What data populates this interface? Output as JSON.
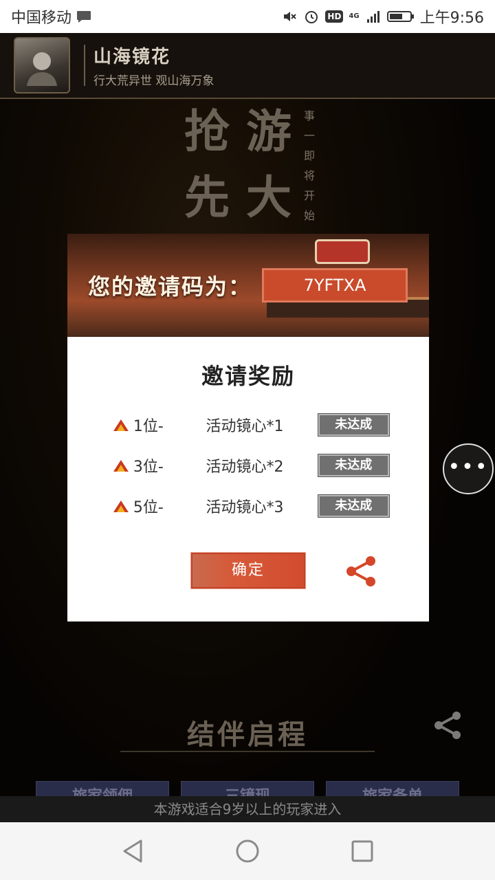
{
  "status_bar": {
    "carrier": "中国移动",
    "hd": "HD",
    "network": "4G",
    "time": "上午9:56"
  },
  "game": {
    "header": {
      "title": "山海镜花",
      "subtitle": "行大荒异世 观山海万象"
    },
    "bg_text": {
      "line1_a": "抢",
      "line1_b": "游",
      "line2_a": "先",
      "line2_b": "大",
      "vertical": "事一即将开始"
    },
    "section_title": "结伴启程",
    "tabs": [
      "旅家领佣",
      "三镜现",
      "旅家备单"
    ],
    "age_notice": "本游戏适合9岁以上的玩家进入"
  },
  "side_more": "•••",
  "modal": {
    "invite_label": "您的邀请码为：",
    "invite_code": "7YFTXA",
    "reward_title": "邀请奖励",
    "rewards": [
      {
        "rank": "1位-",
        "item": "活动镜心*1",
        "status": "未达成"
      },
      {
        "rank": "3位-",
        "item": "活动镜心*2",
        "status": "未达成"
      },
      {
        "rank": "5位-",
        "item": "活动镜心*3",
        "status": "未达成"
      }
    ],
    "confirm_label": "确定"
  },
  "colors": {
    "accent": "#d24c2e",
    "status_gray": "#707070"
  },
  "icons": [
    "chat-icon",
    "mute-icon",
    "alarm-icon",
    "signal-icon",
    "battery-icon",
    "mountain-icon",
    "share-icon",
    "back-icon",
    "home-icon",
    "recents-icon"
  ]
}
